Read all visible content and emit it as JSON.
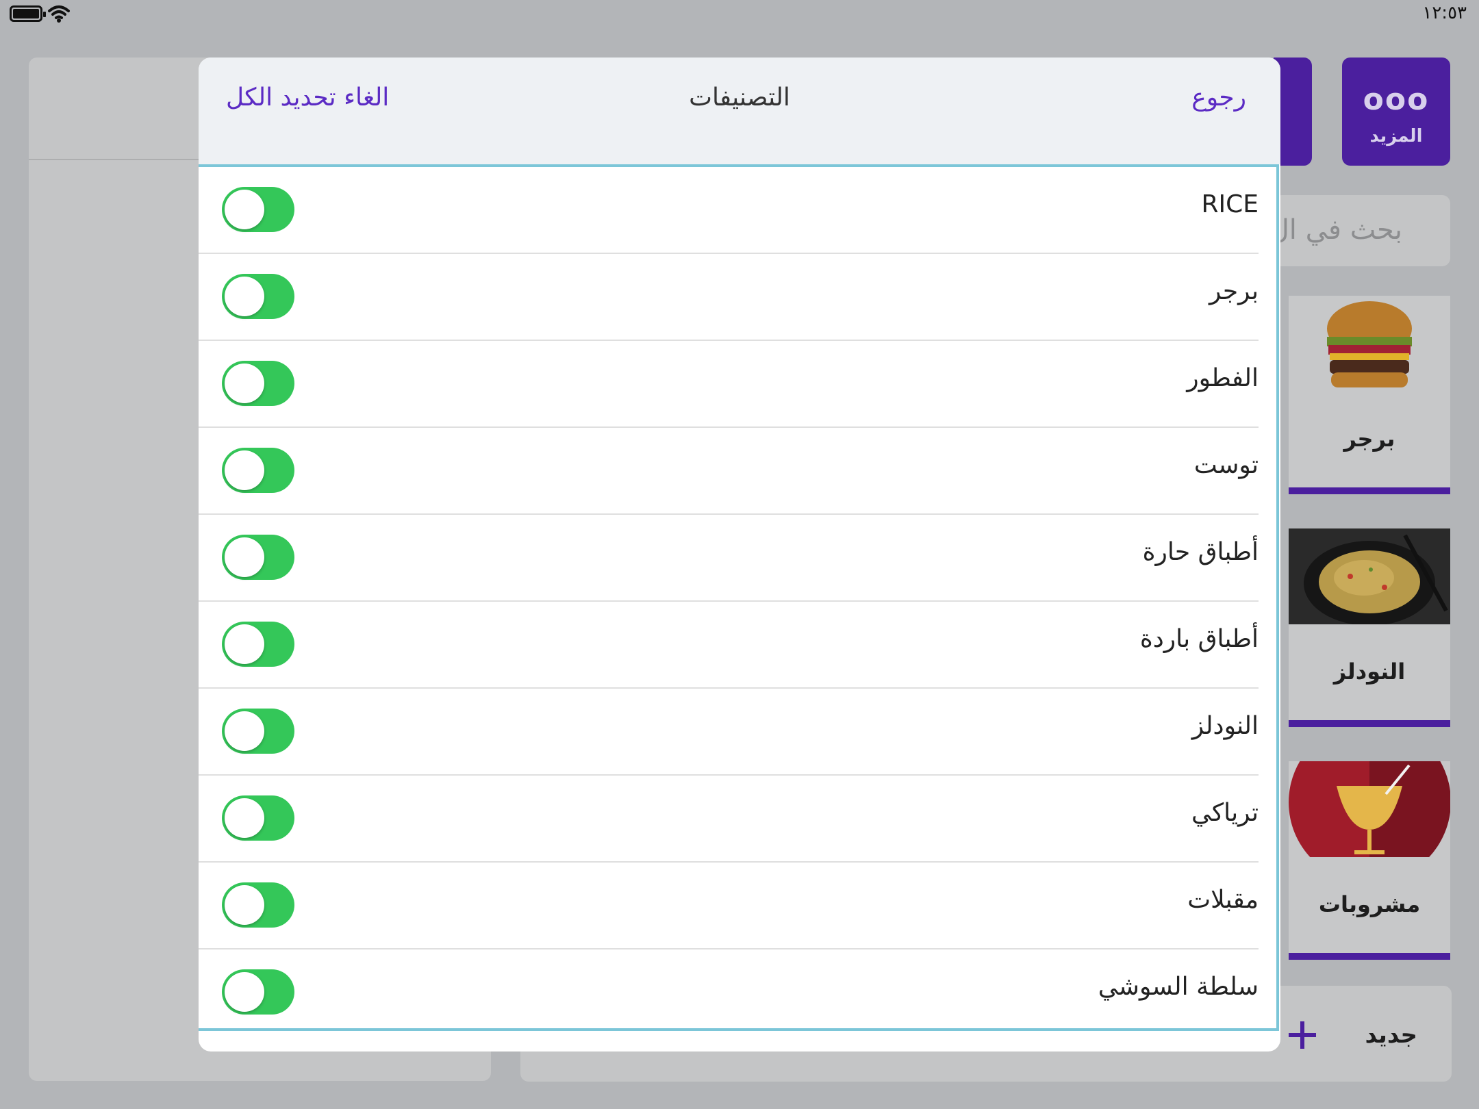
{
  "status_bar": {
    "time": "١٢:٥٣"
  },
  "background": {
    "more_button_label": "المزيد",
    "search_placeholder": "بحث في ال",
    "categories": [
      {
        "label": "برجر"
      },
      {
        "label": "النودلز"
      },
      {
        "label": "مشروبات"
      }
    ],
    "new_button_label": "جديد"
  },
  "modal": {
    "back_label": "رجوع",
    "title": "التصنيفات",
    "deselect_all_label": "الغاء تحديد الكل",
    "items": [
      {
        "label": "RICE",
        "enabled": true
      },
      {
        "label": "برجر",
        "enabled": true
      },
      {
        "label": "الفطور",
        "enabled": true
      },
      {
        "label": "توست",
        "enabled": true
      },
      {
        "label": "أطباق حارة",
        "enabled": true
      },
      {
        "label": "أطباق باردة",
        "enabled": true
      },
      {
        "label": "النودلز",
        "enabled": true
      },
      {
        "label": "ترياكي",
        "enabled": true
      },
      {
        "label": "مقبلات",
        "enabled": true
      },
      {
        "label": "سلطة السوشي",
        "enabled": true
      }
    ]
  },
  "colors": {
    "accent": "#5b2bc4",
    "brand": "#4b1f9e",
    "toggle_on": "#34c759",
    "list_border": "#7cc6d8"
  }
}
